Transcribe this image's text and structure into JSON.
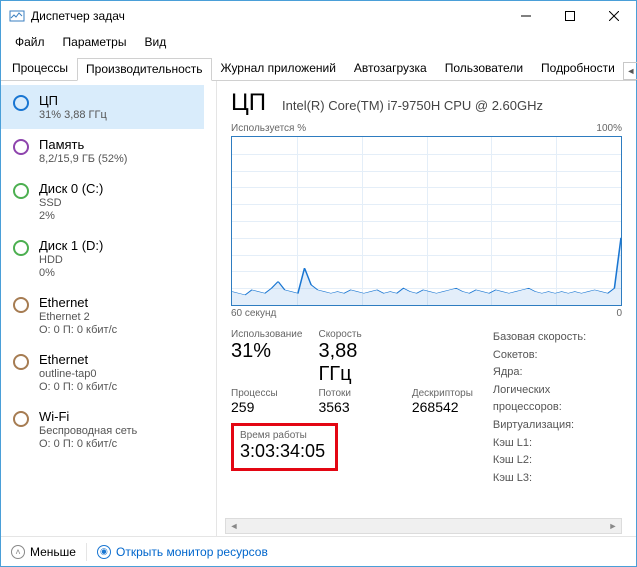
{
  "window": {
    "title": "Диспетчер задач"
  },
  "menu": {
    "file": "Файл",
    "options": "Параметры",
    "view": "Вид"
  },
  "tabs": {
    "processes": "Процессы",
    "performance": "Производительность",
    "apphistory": "Журнал приложений",
    "startup": "Автозагрузка",
    "users": "Пользователи",
    "details": "Подробности"
  },
  "sidebar": [
    {
      "icon": "blue",
      "title": "ЦП",
      "sub": "31% 3,88 ГГц",
      "selected": true
    },
    {
      "icon": "purple",
      "title": "Память",
      "sub": "8,2/15,9 ГБ (52%)"
    },
    {
      "icon": "green",
      "title": "Диск 0 (C:)",
      "sub": "SSD",
      "sub2": "2%"
    },
    {
      "icon": "green",
      "title": "Диск 1 (D:)",
      "sub": "HDD",
      "sub2": "0%"
    },
    {
      "icon": "brown",
      "title": "Ethernet",
      "sub": "Ethernet 2",
      "sub2": "О: 0 П: 0 кбит/с"
    },
    {
      "icon": "brown",
      "title": "Ethernet",
      "sub": "outline-tap0",
      "sub2": "О: 0 П: 0 кбит/с"
    },
    {
      "icon": "brown",
      "title": "Wi-Fi",
      "sub": "Беспроводная сеть",
      "sub2": "О: 0 П: 0 кбит/с"
    }
  ],
  "main": {
    "title": "ЦП",
    "subtitle": "Intel(R) Core(TM) i7-9750H CPU @ 2.60GHz",
    "chartTopLeft": "Используется %",
    "chartTopRight": "100%",
    "chartBotLeft": "60 секунд",
    "chartBotRight": "0",
    "labels": {
      "usage": "Использование",
      "speed": "Скорость",
      "processes": "Процессы",
      "threads": "Потоки",
      "handles": "Дескрипторы",
      "uptime": "Время работы",
      "baseSpeed": "Базовая скорость:",
      "sockets": "Сокетов:",
      "cores": "Ядра:",
      "lprocs": "Логических процессоров:",
      "virt": "Виртуализация:",
      "l1": "Кэш L1:",
      "l2": "Кэш L2:",
      "l3": "Кэш L3:"
    },
    "values": {
      "usage": "31%",
      "speed": "3,88 ГГц",
      "processes": "259",
      "threads": "3563",
      "handles": "268542",
      "uptime": "3:03:34:05"
    }
  },
  "footer": {
    "less": "Меньше",
    "monitor": "Открыть монитор ресурсов"
  },
  "chart_data": {
    "type": "line",
    "title": "Используется %",
    "xlabel": "60 секунд",
    "ylabel": "",
    "ylim": [
      0,
      100
    ],
    "xlim": [
      60,
      0
    ],
    "values": [
      8,
      7,
      6,
      9,
      8,
      7,
      10,
      14,
      9,
      8,
      7,
      22,
      12,
      9,
      8,
      7,
      8,
      7,
      9,
      8,
      7,
      8,
      9,
      7,
      8,
      7,
      10,
      8,
      7,
      9,
      8,
      7,
      8,
      9,
      10,
      8,
      7,
      9,
      8,
      7,
      9,
      8,
      7,
      8,
      9,
      10,
      8,
      7,
      8,
      7,
      8,
      7,
      8,
      7,
      8,
      9,
      8,
      7,
      10,
      40
    ]
  }
}
